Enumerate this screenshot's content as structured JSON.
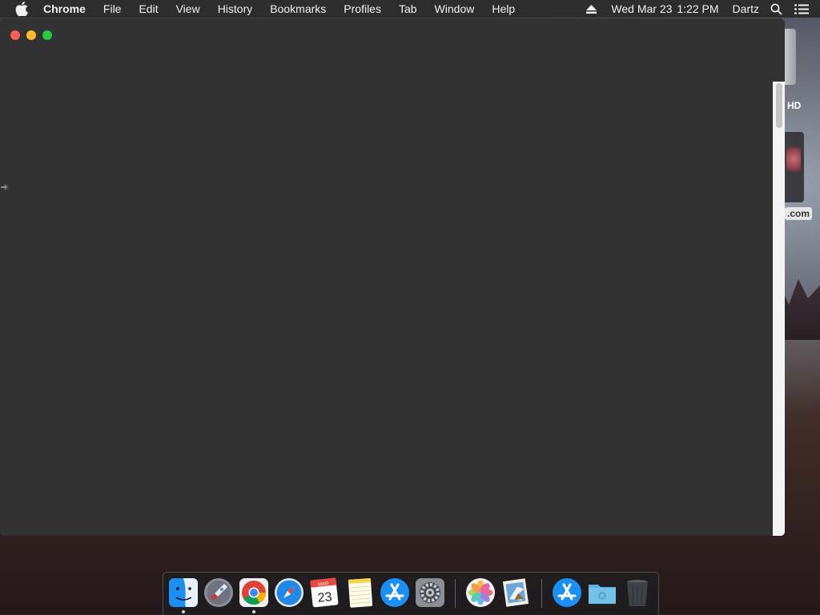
{
  "menubar": {
    "app_name": "Chrome",
    "items": [
      "File",
      "Edit",
      "View",
      "History",
      "Bookmarks",
      "Profiles",
      "Tab",
      "Window",
      "Help"
    ],
    "date": "Wed Mar 23",
    "time": "1:22 PM",
    "user": "Dartz"
  },
  "desktop": {
    "disk_label": "HD",
    "file_label": ".com"
  },
  "dock": {
    "calendar_month": "MAR",
    "calendar_day": "23",
    "apps": [
      "finder",
      "launchpad",
      "chrome",
      "safari",
      "calendar",
      "notes",
      "app-store",
      "system-preferences",
      "photos",
      "mail",
      "app-store-downloads",
      "folder",
      "trash"
    ]
  },
  "colors": {
    "close": "#fc5f57",
    "minimize": "#fdbc2e",
    "maximize": "#28c841",
    "window_bg": "#323232"
  }
}
